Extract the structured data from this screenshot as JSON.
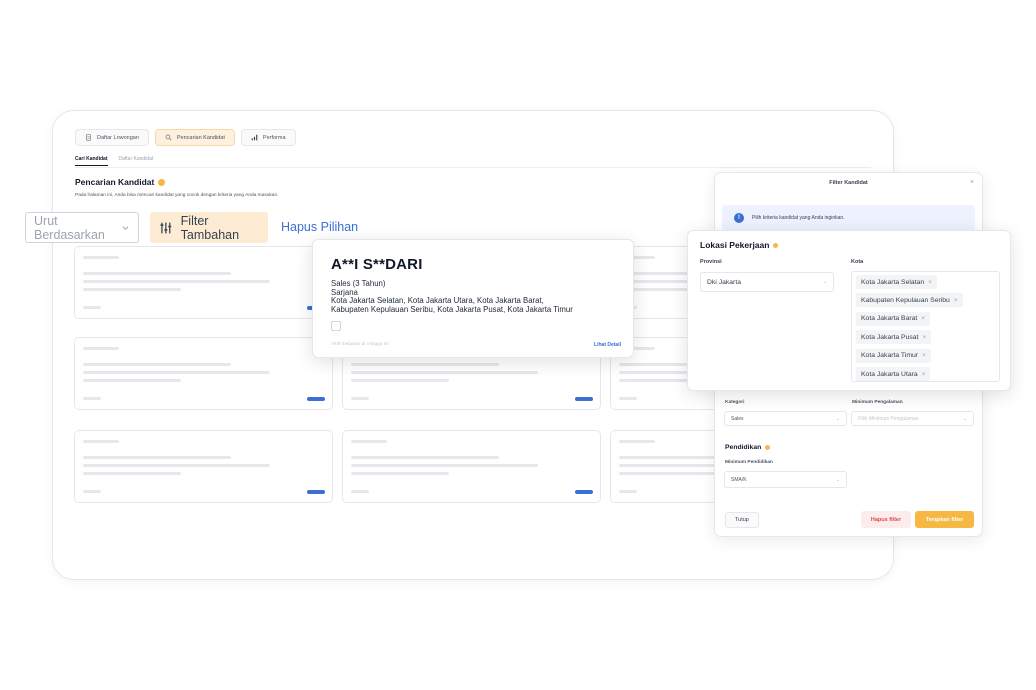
{
  "tabs": [
    {
      "label": "Daftar Lowongan",
      "icon": "document-icon"
    },
    {
      "label": "Pencarian Kandidat",
      "icon": "search-icon"
    },
    {
      "label": "Performa",
      "icon": "bar-chart-icon"
    }
  ],
  "subtabs": [
    "Cari Kandidat",
    "Daftar Kandidat"
  ],
  "page": {
    "title": "Pencarian Kandidat",
    "description": "Pada halaman ini, Anda bisa mencari kandidat yang cocok dengan kriteria yang Anda masukan."
  },
  "toolbar": {
    "sort_label": "Urut Berdasarkan",
    "filter_label": "Filter Tambahan",
    "reset_label": "Hapus Pilihan"
  },
  "candidate": {
    "name": "A**I S**DARI",
    "experience": "Sales (3 Tahun)",
    "education": "Sarjana",
    "locations_line1": "Kota Jakarta Selatan, Kota Jakarta Utara, Kota Jakarta Barat,",
    "locations_line2": "Kabupaten Kepulauan Seribu, Kota Jakarta Pusat, Kota Jakarta Timur",
    "activity": "Aktif melamar di minggu ini",
    "detail_link": "Lihat Detail"
  },
  "filter_modal": {
    "title": "Filter Kandidat",
    "close": "×",
    "info": "Pilih kriteria kandidat yang Anda inginkan.",
    "kategori_label": "Kategori",
    "kategori_value": "Sales",
    "pengalaman_label": "Minimum Pengalaman",
    "pengalaman_placeholder": "Pilih Minimum Pengalaman",
    "pendidikan_title": "Pendidikan",
    "min_pendidikan_label": "Minimum Pendidikan",
    "min_pendidikan_value": "SMA/K",
    "tutup_label": "Tutup",
    "hapus_label": "Hapus filter",
    "terapkan_label": "Terapkan filter"
  },
  "location": {
    "title": "Lokasi Pekerjaan",
    "provinsi_label": "Provinsi",
    "provinsi_value": "Dki Jakarta",
    "kota_label": "Kota",
    "cities": [
      "Kota Jakarta Selatan",
      "Kabupaten Kepulauan Seribu",
      "Kota Jakarta Barat",
      "Kota Jakarta Pusat",
      "Kota Jakarta Timur",
      "Kota Jakarta Utara"
    ]
  },
  "colors": {
    "accent": "#f6b743",
    "accent_soft": "#fdecd3",
    "link": "#3b6fd4",
    "danger": "#e0474c"
  }
}
